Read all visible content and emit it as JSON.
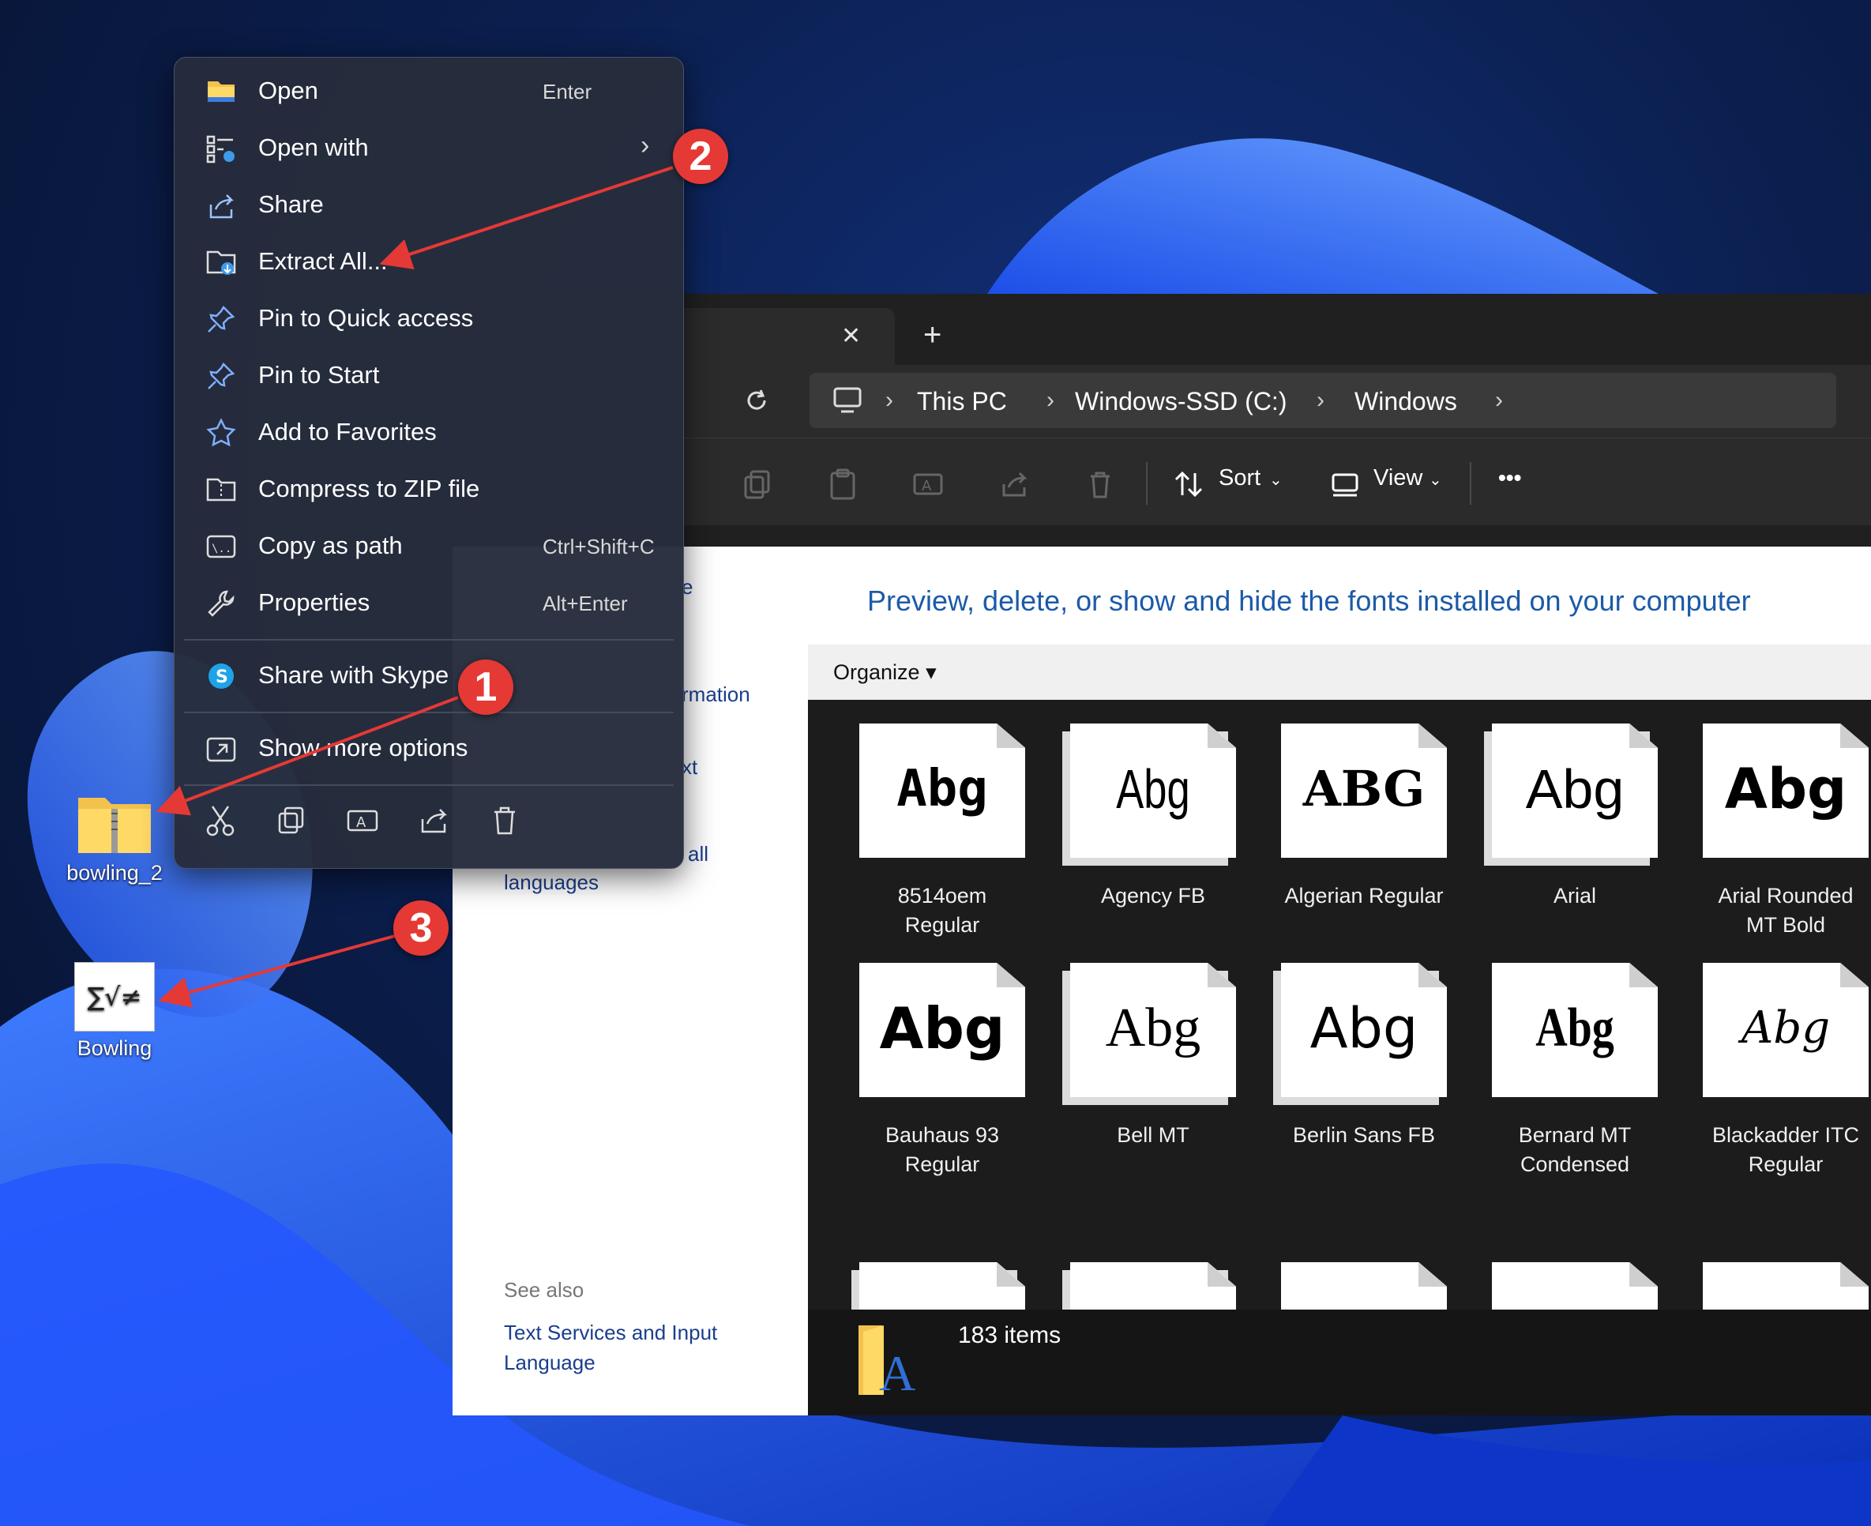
{
  "desktop": {
    "icons": [
      {
        "label": "bowling_2",
        "icon": "zip-folder-icon"
      },
      {
        "label": "Bowling",
        "icon": "math-file-icon",
        "glyph": "∑√≠"
      }
    ]
  },
  "context_menu": {
    "items": [
      {
        "label": "Open",
        "shortcut": "Enter",
        "icon": "folder-icon"
      },
      {
        "label": "Open with",
        "shortcut": "",
        "icon": "open-with-icon",
        "submenu": "›"
      },
      {
        "label": "Share",
        "shortcut": "",
        "icon": "share-icon"
      },
      {
        "label": "Extract All...",
        "shortcut": "",
        "icon": "extract-icon"
      },
      {
        "label": "Pin to Quick access",
        "shortcut": "",
        "icon": "pin-icon"
      },
      {
        "label": "Pin to Start",
        "shortcut": "",
        "icon": "pin-icon"
      },
      {
        "label": "Add to Favorites",
        "shortcut": "",
        "icon": "star-icon"
      },
      {
        "label": "Compress to ZIP file",
        "shortcut": "",
        "icon": "zip-icon"
      },
      {
        "label": "Copy as path",
        "shortcut": "Ctrl+Shift+C",
        "icon": "copy-path-icon"
      },
      {
        "label": "Properties",
        "shortcut": "Alt+Enter",
        "icon": "wrench-icon"
      },
      {
        "label": "Share with Skype",
        "shortcut": "",
        "icon": "skype-icon"
      },
      {
        "label": "Show more options",
        "shortcut": "",
        "icon": "more-options-icon"
      }
    ],
    "quick_actions": [
      "cut-icon",
      "copy-icon",
      "rename-icon",
      "share-icon",
      "delete-icon"
    ]
  },
  "explorer": {
    "tab_close": "✕",
    "tab_add": "+",
    "breadcrumbs": [
      "This PC",
      "Windows-SSD (C:)",
      "Windows"
    ],
    "toolbar": {
      "sort_label": "Sort",
      "view_label": "View",
      "more_label": "•••"
    },
    "left_pane": {
      "fragments": [
        "e",
        "rmation",
        "xt",
        "all"
      ],
      "languages": "languages",
      "see_also": "See also",
      "link_line1": "Text Services and Input",
      "link_line2": "Language"
    },
    "content_title": "Preview, delete, or show and hide the fonts installed on your computer",
    "organize": "Organize",
    "fonts": [
      {
        "sample": "Abg",
        "name1": "8514oem",
        "name2": "Regular"
      },
      {
        "sample": "Abg",
        "name1": "Agency FB",
        "name2": ""
      },
      {
        "sample": "ABG",
        "name1": "Algerian Regular",
        "name2": ""
      },
      {
        "sample": "Abg",
        "name1": "Arial",
        "name2": ""
      },
      {
        "sample": "Abg",
        "name1": "Arial Rounded",
        "name2": "MT Bold"
      },
      {
        "sample": "Abg",
        "name1": "Bauhaus 93",
        "name2": "Regular"
      },
      {
        "sample": "Abg",
        "name1": "Bell MT",
        "name2": ""
      },
      {
        "sample": "Abg",
        "name1": "Berlin Sans FB",
        "name2": ""
      },
      {
        "sample": "Abg",
        "name1": "Bernard MT",
        "name2": "Condensed"
      },
      {
        "sample": "Abg",
        "name1": "Blackadder ITC",
        "name2": "Regular"
      }
    ],
    "status": "183 items"
  },
  "annotations": [
    "1",
    "2",
    "3"
  ],
  "colors": {
    "accent": "#1c5aa8",
    "badge": "#e53935",
    "menu_bg": "#262c3c"
  }
}
